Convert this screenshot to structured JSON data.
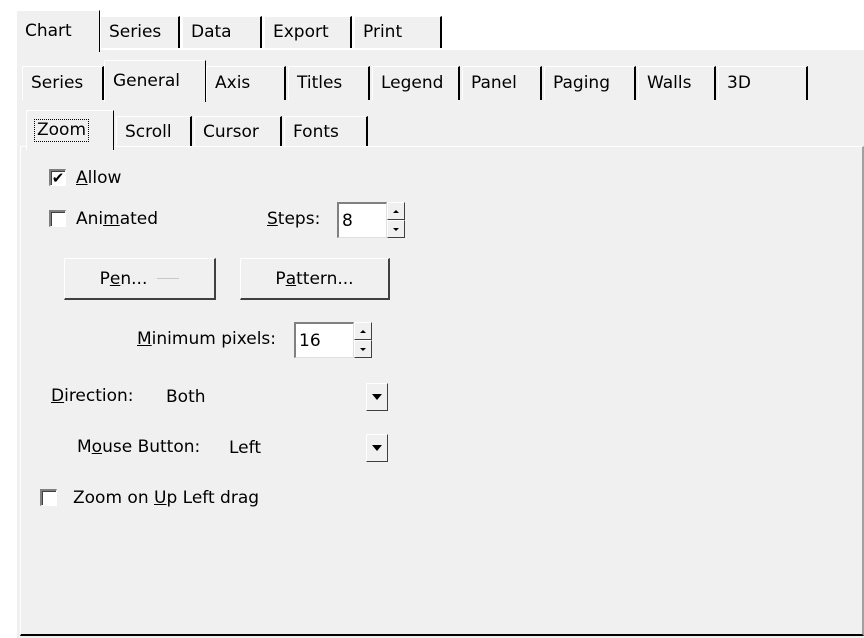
{
  "tabs_top": [
    "Chart",
    "Series",
    "Data",
    "Export",
    "Print"
  ],
  "tabs_second": [
    "Series",
    "General",
    "Axis",
    "Titles",
    "Legend",
    "Panel",
    "Paging",
    "Walls",
    "3D"
  ],
  "tabs_third": [
    "Zoom",
    "Scroll",
    "Cursor",
    "Fonts"
  ],
  "zoom": {
    "allow_label_first": "A",
    "allow_label_rest": "llow",
    "allow_checked": true,
    "animated_label_pre": "Ani",
    "animated_label_u": "m",
    "animated_label_post": "ated",
    "animated_checked": false,
    "steps_label_u": "S",
    "steps_label_rest": "teps:",
    "steps_value": "8",
    "pen_button_pre": "P",
    "pen_button_u": "e",
    "pen_button_post": "n...",
    "pattern_button_pre": "P",
    "pattern_button_u": "a",
    "pattern_button_post": "ttern...",
    "min_pixels_label_u": "M",
    "min_pixels_label_rest": "inimum pixels:",
    "min_pixels_value": "16",
    "direction_label_u": "D",
    "direction_label_rest": "irection:",
    "direction_value": "Both",
    "mouse_button_label_pre": "M",
    "mouse_button_label_u": "o",
    "mouse_button_label_post": "use Button:",
    "mouse_button_value": "Left",
    "zoom_on_up_pre": "Zoom on ",
    "zoom_on_up_u": "U",
    "zoom_on_up_post": "p Left drag",
    "zoom_on_up_checked": false
  }
}
